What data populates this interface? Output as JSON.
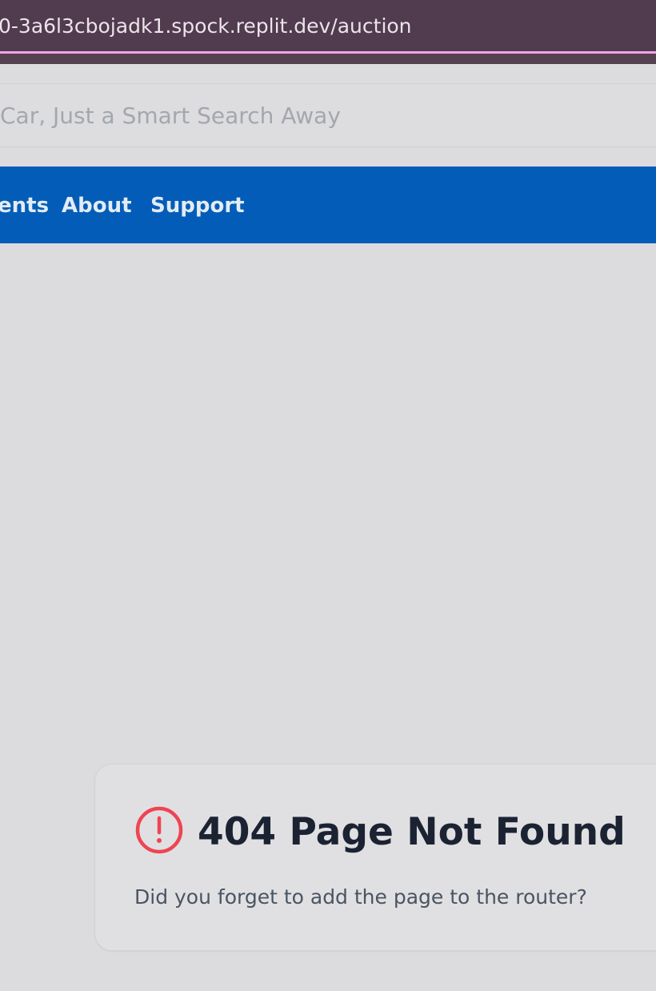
{
  "browser": {
    "url": "0-3a6l3cbojadk1.spock.replit.dev/auction"
  },
  "search": {
    "placeholder": "Car, Just a Smart Search Away"
  },
  "nav": {
    "items": [
      {
        "label": "ents"
      },
      {
        "label": "About"
      },
      {
        "label": "Support"
      }
    ]
  },
  "error": {
    "icon": "alert-circle-icon",
    "title": "404 Page Not Found",
    "message": "Did you forget to add the page to the router?"
  },
  "colors": {
    "nav_background": "#035db8",
    "url_bar": "#513b4f",
    "error_icon": "#ef4452",
    "page_background": "#dcdcde"
  }
}
